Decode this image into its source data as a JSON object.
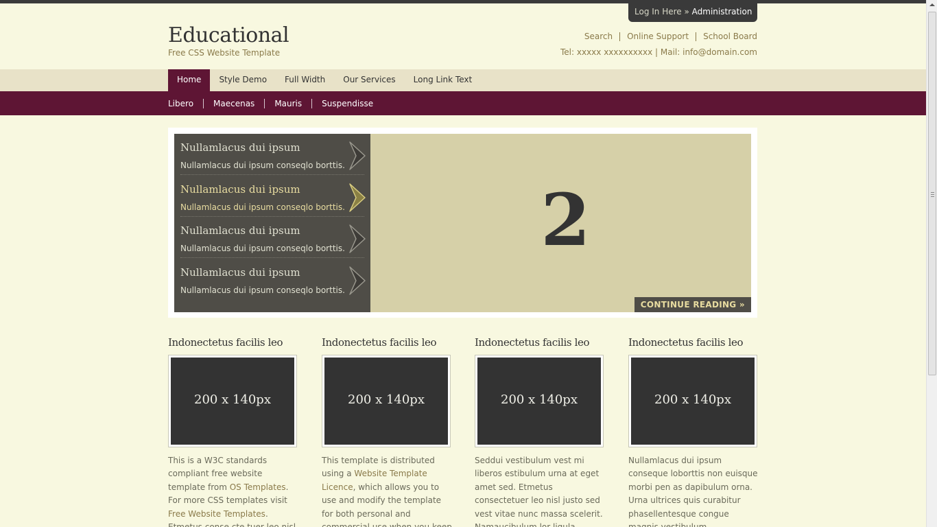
{
  "header": {
    "login": {
      "prefix": "Log In Here",
      "sep": " » ",
      "admin": "Administration"
    },
    "logo": "Educational",
    "tagline": "Free CSS Website Template",
    "links": [
      "Search",
      "Online Support",
      "School Board"
    ],
    "contact": "Tel: xxxxx xxxxxxxxxx | Mail: info@domain.com"
  },
  "nav": {
    "items": [
      "Home",
      "Style Demo",
      "Full Width",
      "Our Services",
      "Long Link Text"
    ],
    "active": "Home"
  },
  "subnav": {
    "items": [
      "Libero",
      "Maecenas",
      "Mauris",
      "Suspendisse"
    ]
  },
  "slider": {
    "items": [
      {
        "title": "Nullamlacus dui ipsum",
        "desc": "Nullamlacus dui ipsum conseqlo borttis."
      },
      {
        "title": "Nullamlacus dui ipsum",
        "desc": "Nullamlacus dui ipsum conseqlo borttis."
      },
      {
        "title": "Nullamlacus dui ipsum",
        "desc": "Nullamlacus dui ipsum conseqlo borttis."
      },
      {
        "title": "Nullamlacus dui ipsum",
        "desc": "Nullamlacus dui ipsum conseqlo borttis."
      }
    ],
    "active_index": 1,
    "current": "2",
    "continue_label": "CONTINUE READING »"
  },
  "columns": [
    {
      "title": "Indonectetus facilis leo",
      "image": "200 x 140px",
      "text_parts": [
        {
          "t": "This is a W3C standards compliant free website template from ",
          "link": false
        },
        {
          "t": "OS Templates",
          "link": true
        },
        {
          "t": ". For more CSS templates visit ",
          "link": false
        },
        {
          "t": "Free Website Templates",
          "link": true
        },
        {
          "t": ". Etmetus conse cte tuer leo nisl justo sed",
          "link": false
        }
      ]
    },
    {
      "title": "Indonectetus facilis leo",
      "image": "200 x 140px",
      "text_parts": [
        {
          "t": "This template is distributed using a ",
          "link": false
        },
        {
          "t": "Website Template Licence",
          "link": true
        },
        {
          "t": ", which allows you to use and modify the template for both personal and commercial use when you keep the provided",
          "link": false
        }
      ]
    },
    {
      "title": "Indonectetus facilis leo",
      "image": "200 x 140px",
      "text_parts": [
        {
          "t": "Seddui vestibulum vest mi liberos estibulum urna at eget amet sed. Etmetus consectetuer leo nisl justo sed vest vitae nunc massa scelerit. Namaucibulum lor ligula nullam risque et ristic",
          "link": false
        }
      ]
    },
    {
      "title": "Indonectetus facilis leo",
      "image": "200 x 140px",
      "text_parts": [
        {
          "t": "Nullamlacus dui ipsum conseque loborttis non euisque morbi pen as dapibulum orna. Urna ultrices quis curabitur phasellentesque congue magnis vestibulum. Orciloifendimentum",
          "link": false
        }
      ]
    }
  ],
  "colors": {
    "background": "#f8f8e0",
    "brand": "#5e1534",
    "nav_bg": "#e8e2c8",
    "slider_panel": "#4f4d47",
    "slider_view": "#d6d0a8",
    "accent_text": "#e8dca0",
    "link": "#8a7a4a"
  },
  "icons": {
    "slide_arrow": "chevron-right-icon"
  }
}
